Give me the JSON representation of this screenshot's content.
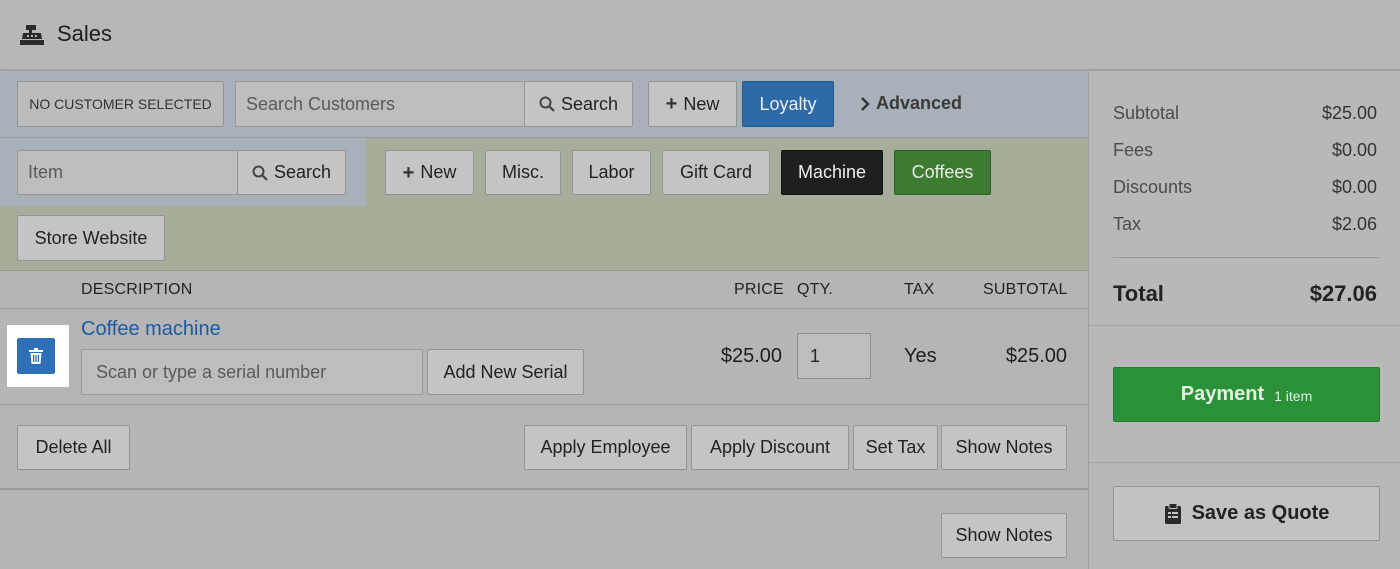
{
  "header": {
    "title": "Sales",
    "icon": "register-icon"
  },
  "customer": {
    "no_customer_label": "NO CUSTOMER SELECTED",
    "search_placeholder": "Search Customers",
    "search_label": "Search",
    "new_label": "New",
    "loyalty_label": "Loyalty",
    "advanced_label": "Advanced"
  },
  "item_bar": {
    "item_placeholder": "Item",
    "search_label": "Search",
    "new_label": "New",
    "quick_buttons": [
      "Misc.",
      "Labor",
      "Gift Card",
      "Machine",
      "Coffees"
    ],
    "store_website_label": "Store Website"
  },
  "columns": {
    "description": "DESCRIPTION",
    "price": "PRICE",
    "qty": "QTY.",
    "tax": "TAX",
    "subtotal": "SUBTOTAL"
  },
  "line_items": [
    {
      "name": "Coffee machine",
      "serial_placeholder": "Scan or type a serial number",
      "add_serial_label": "Add New Serial",
      "price": "$25.00",
      "qty": "1",
      "tax": "Yes",
      "subtotal": "$25.00"
    }
  ],
  "actions": {
    "delete_all": "Delete All",
    "apply_employee": "Apply Employee",
    "apply_discount": "Apply Discount",
    "set_tax": "Set Tax",
    "show_notes": "Show Notes",
    "show_notes_2": "Show Notes"
  },
  "summary": {
    "subtotal_label": "Subtotal",
    "subtotal": "$25.00",
    "fees_label": "Fees",
    "fees": "$0.00",
    "discounts_label": "Discounts",
    "discounts": "$0.00",
    "tax_label": "Tax",
    "tax": "$2.06",
    "total_label": "Total",
    "total": "$27.06",
    "payment_label": "Payment",
    "payment_count": "1 item",
    "save_quote_label": "Save as Quote"
  },
  "colors": {
    "loyalty": "#2e6ba6",
    "machine": "#1f1f1f",
    "coffees": "#3f7a32",
    "payment": "#2a9139",
    "link": "#1f5aa0",
    "delete_icon_bg": "#2f6fb8"
  }
}
